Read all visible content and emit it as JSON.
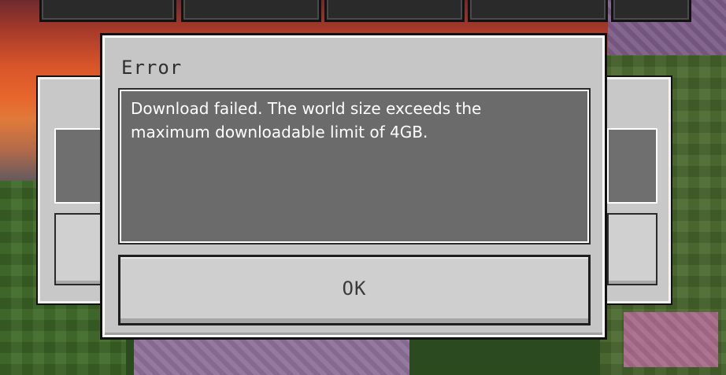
{
  "dialog": {
    "title": "Error",
    "message": "Download failed. The world size exceeds the\nmaximum downloadable limit of 4GB.",
    "ok_label": "OK"
  },
  "colors": {
    "panel": "#c6c6c6",
    "message_box": "#6b6b6b",
    "text_light": "#ffffff",
    "text_dark": "#2f2f2f"
  }
}
